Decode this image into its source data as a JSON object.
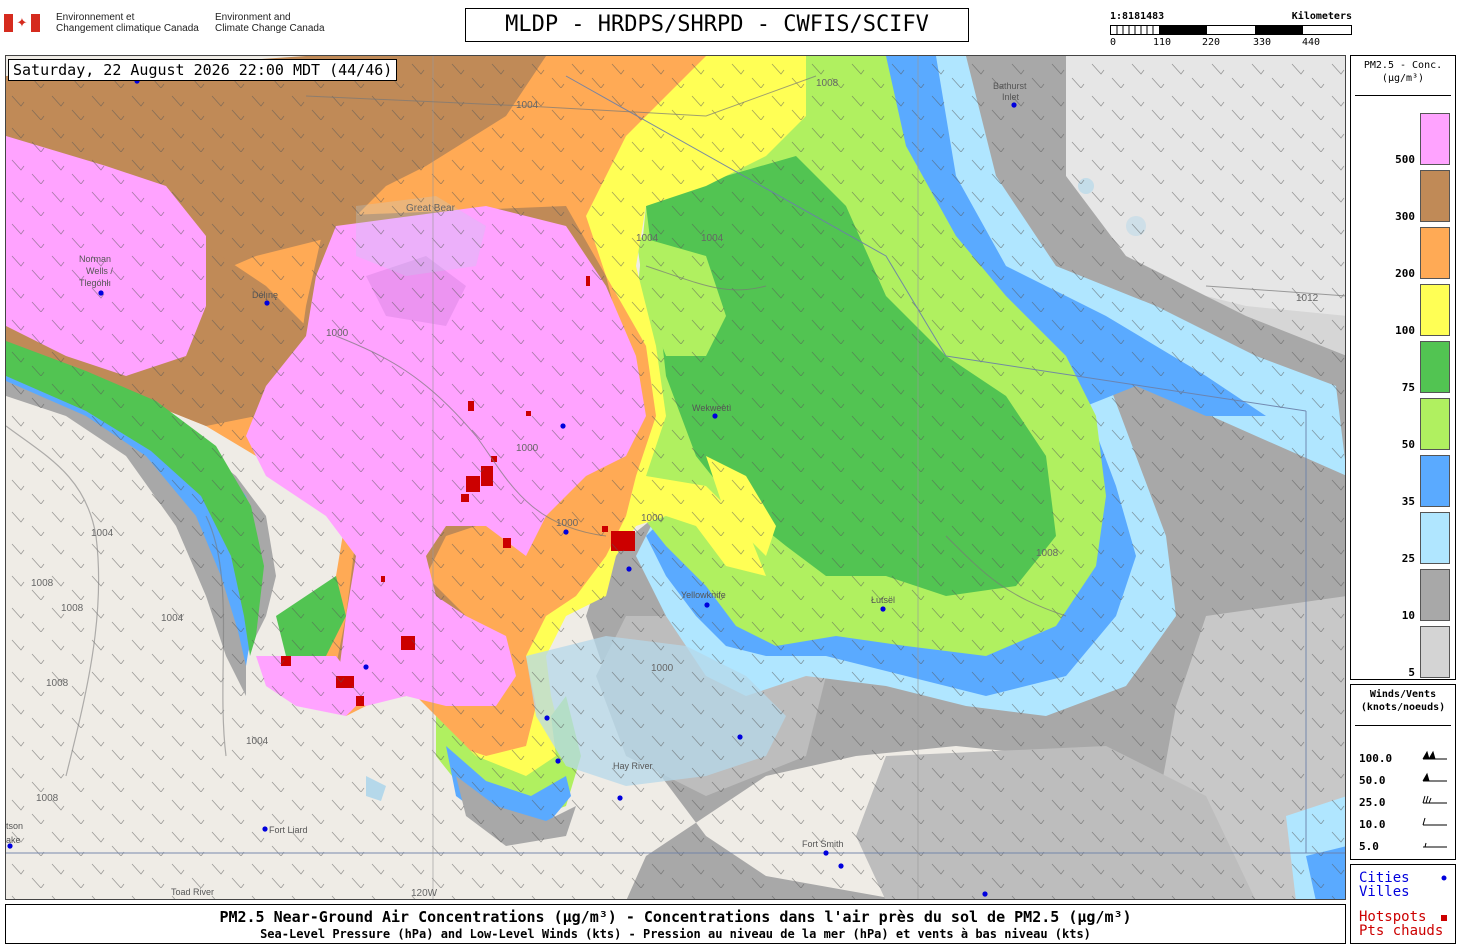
{
  "header": {
    "dept_fr": [
      "Environnement et",
      "Changement climatique Canada"
    ],
    "dept_en": [
      "Environment and",
      "Climate Change Canada"
    ],
    "title": "MLDP - HRDPS/SHRPD - CWFIS/SCIFV"
  },
  "scale": {
    "ratio": "1:8181483",
    "unit": "Kilometers",
    "ticks": [
      "0",
      "110",
      "220",
      "330",
      "440"
    ]
  },
  "map": {
    "timestamp": "Saturday, 22 August 2026 22:00 MDT (44/46)",
    "cities": [
      {
        "name": "Norman Wells / Tlegóhłı",
        "label": [
          "Norman",
          "Wells /",
          "Tlegóhłı"
        ]
      },
      {
        "name": "Délı̨nę",
        "label": [
          "Délı̨nę"
        ]
      },
      {
        "name": "Wekweètì",
        "label": [
          "Wekweètì"
        ]
      },
      {
        "name": "Yellowknife",
        "label": [
          "Yellowknife"
        ]
      },
      {
        "name": "Łutsël K'é",
        "label": [
          "Łutsël"
        ]
      },
      {
        "name": "Hay River",
        "label": [
          "Hay River"
        ]
      },
      {
        "name": "Fort Liard",
        "label": [
          "Fort Liard"
        ]
      },
      {
        "name": "Fort Smith",
        "label": [
          "Fort Smith"
        ]
      },
      {
        "name": "Bathurst Inlet",
        "label": [
          "Bathurst",
          "Inlet"
        ]
      },
      {
        "name": "Toad River",
        "label": [
          "Toad River"
        ]
      },
      {
        "name": "Watson Lake",
        "label": [
          "tson",
          "ake"
        ]
      }
    ],
    "isobars": [
      "1000",
      "1000",
      "1000",
      "1000",
      "1000",
      "1004",
      "1004",
      "1004",
      "1004",
      "1004",
      "1004",
      "1008",
      "1008",
      "1008",
      "1008",
      "1008",
      "1008",
      "1012"
    ],
    "other_labels": [
      "Great Bear",
      "120W"
    ]
  },
  "legend": {
    "title": [
      "PM2.5 - Conc.",
      "(µg/m³)"
    ],
    "levels": [
      {
        "label": "500",
        "color": "#ffa3ff"
      },
      {
        "label": "300",
        "color": "#c08a57"
      },
      {
        "label": "200",
        "color": "#ffaa55"
      },
      {
        "label": "100",
        "color": "#ffff55"
      },
      {
        "label": "75",
        "color": "#52c452"
      },
      {
        "label": "50",
        "color": "#b0f060"
      },
      {
        "label": "35",
        "color": "#5aaaff"
      },
      {
        "label": "25",
        "color": "#b0e6ff"
      },
      {
        "label": "10",
        "color": "#a8a8a8"
      },
      {
        "label": "5",
        "color": "#d4d4d4"
      }
    ]
  },
  "winds_legend": {
    "title": [
      "Winds/Vents",
      "(knots/noeuds)"
    ],
    "rows": [
      "100.0",
      "50.0",
      "25.0",
      "10.0",
      "5.0"
    ]
  },
  "key": {
    "cities": "Cities",
    "villes": "Villes",
    "hotspots": "Hotspots",
    "pts_chauds": "Pts chauds",
    "city_color": "#0000dd",
    "hotspot_color": "#cc0000"
  },
  "footer": {
    "line1": "PM2.5 Near-Ground Air Concentrations (µg/m³) - Concentrations dans l'air près du sol de PM2.5 (µg/m³)",
    "line2": "Sea-Level Pressure (hPa) and Low-Level Winds (kts) - Pression au niveau de la mer (hPa) et vents à bas niveau (kts)"
  }
}
